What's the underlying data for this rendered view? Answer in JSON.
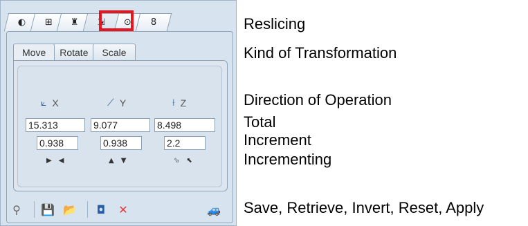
{
  "top_tabs": [
    {
      "icon": "contrast-icon",
      "glyph": "◐"
    },
    {
      "icon": "grid-icon",
      "glyph": "⊞"
    },
    {
      "icon": "figure-icon",
      "glyph": "♜"
    },
    {
      "icon": "reslice-icon",
      "glyph": "⇲",
      "active": true
    },
    {
      "icon": "binoculars-icon",
      "glyph": "⊙"
    },
    {
      "icon": "pin-icon",
      "glyph": "8"
    }
  ],
  "sub_tabs": [
    "Move",
    "Rotate",
    "Scale"
  ],
  "axes": [
    "X",
    "Y",
    "Z"
  ],
  "total": [
    "15.313",
    "9.077",
    "8.498"
  ],
  "increment": [
    "0.938",
    "0.938",
    "2.2"
  ],
  "incrementing": [
    [
      "▶",
      "◀"
    ],
    [
      "▲",
      "▼"
    ],
    [
      "⬂",
      "⬉"
    ]
  ],
  "toolbar": {
    "pin": "⚲",
    "save": "💾",
    "retrieve": "📂",
    "invert": "◘",
    "reset": "✕",
    "apply": "🚙"
  },
  "colors": {
    "reset": "#e53935",
    "active_highlight": "#e8141e"
  },
  "labels": {
    "reslicing": "Reslicing",
    "kind": "Kind of Transformation",
    "direction": "Direction of Operation",
    "total": "Total",
    "increment": "Increment",
    "incrementing": "Incrementing",
    "actions": "Save, Retrieve, Invert, Reset, Apply"
  }
}
